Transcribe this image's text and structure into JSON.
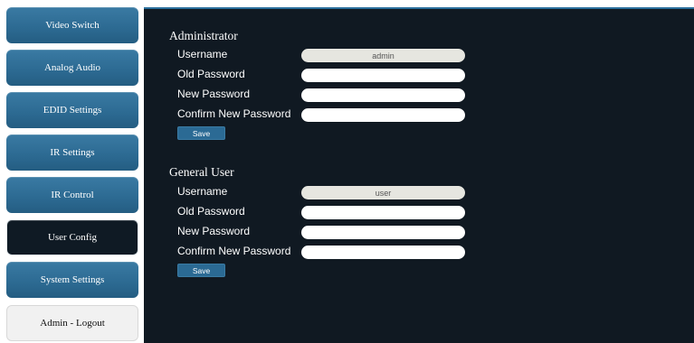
{
  "sidebar": {
    "items": [
      {
        "label": "Video Switch"
      },
      {
        "label": "Analog Audio"
      },
      {
        "label": "EDID Settings"
      },
      {
        "label": "IR Settings"
      },
      {
        "label": "IR Control"
      },
      {
        "label": "User Config"
      },
      {
        "label": "System Settings"
      },
      {
        "label": "Admin - Logout"
      }
    ],
    "active": "User Config"
  },
  "administrator": {
    "title": "Administrator",
    "username_label": "Username",
    "username_value": "admin",
    "old_password_label": "Old Password",
    "old_password_value": "",
    "new_password_label": "New Password",
    "new_password_value": "",
    "confirm_password_label": "Confirm New Password",
    "confirm_password_value": "",
    "save_label": "Save"
  },
  "general_user": {
    "title": "General User",
    "username_label": "Username",
    "username_value": "user",
    "old_password_label": "Old Password",
    "old_password_value": "",
    "new_password_label": "New Password",
    "new_password_value": "",
    "confirm_password_label": "Confirm New Password",
    "confirm_password_value": "",
    "save_label": "Save"
  },
  "colors": {
    "nav_button": "#2d6b93",
    "panel_background": "#101922",
    "accent": "#2a6f9c"
  }
}
